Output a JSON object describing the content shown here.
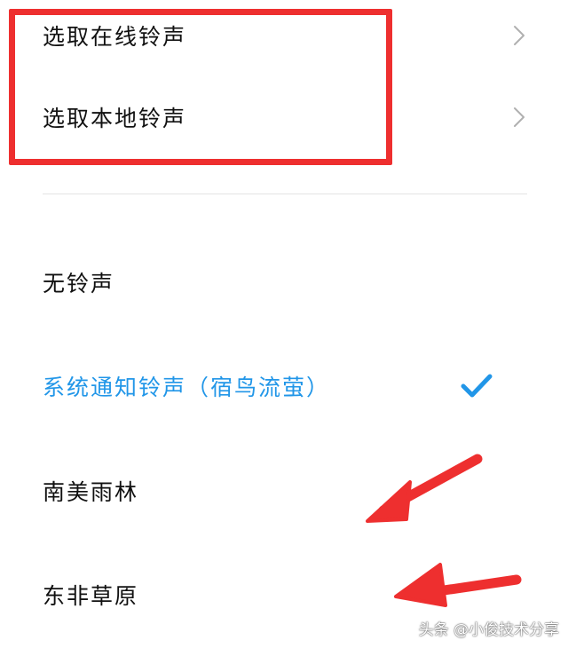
{
  "picker": {
    "online_label": "选取在线铃声",
    "local_label": "选取本地铃声"
  },
  "ringtones": [
    {
      "label": "无铃声",
      "selected": false
    },
    {
      "label": "系统通知铃声（宿鸟流萤）",
      "selected": true
    },
    {
      "label": "南美雨林",
      "selected": false
    },
    {
      "label": "东非草原",
      "selected": false
    }
  ],
  "watermark": "头条 @小俊技术分享",
  "icons": {
    "chevron": "chevron-right-icon",
    "check": "check-icon",
    "annotation_arrow": "red-arrow-icon"
  },
  "colors": {
    "selected": "#2196e8",
    "annotation": "#ee2f2f",
    "text": "#111111",
    "chevron": "#b0b0b0",
    "divider": "#e4e4e4"
  }
}
